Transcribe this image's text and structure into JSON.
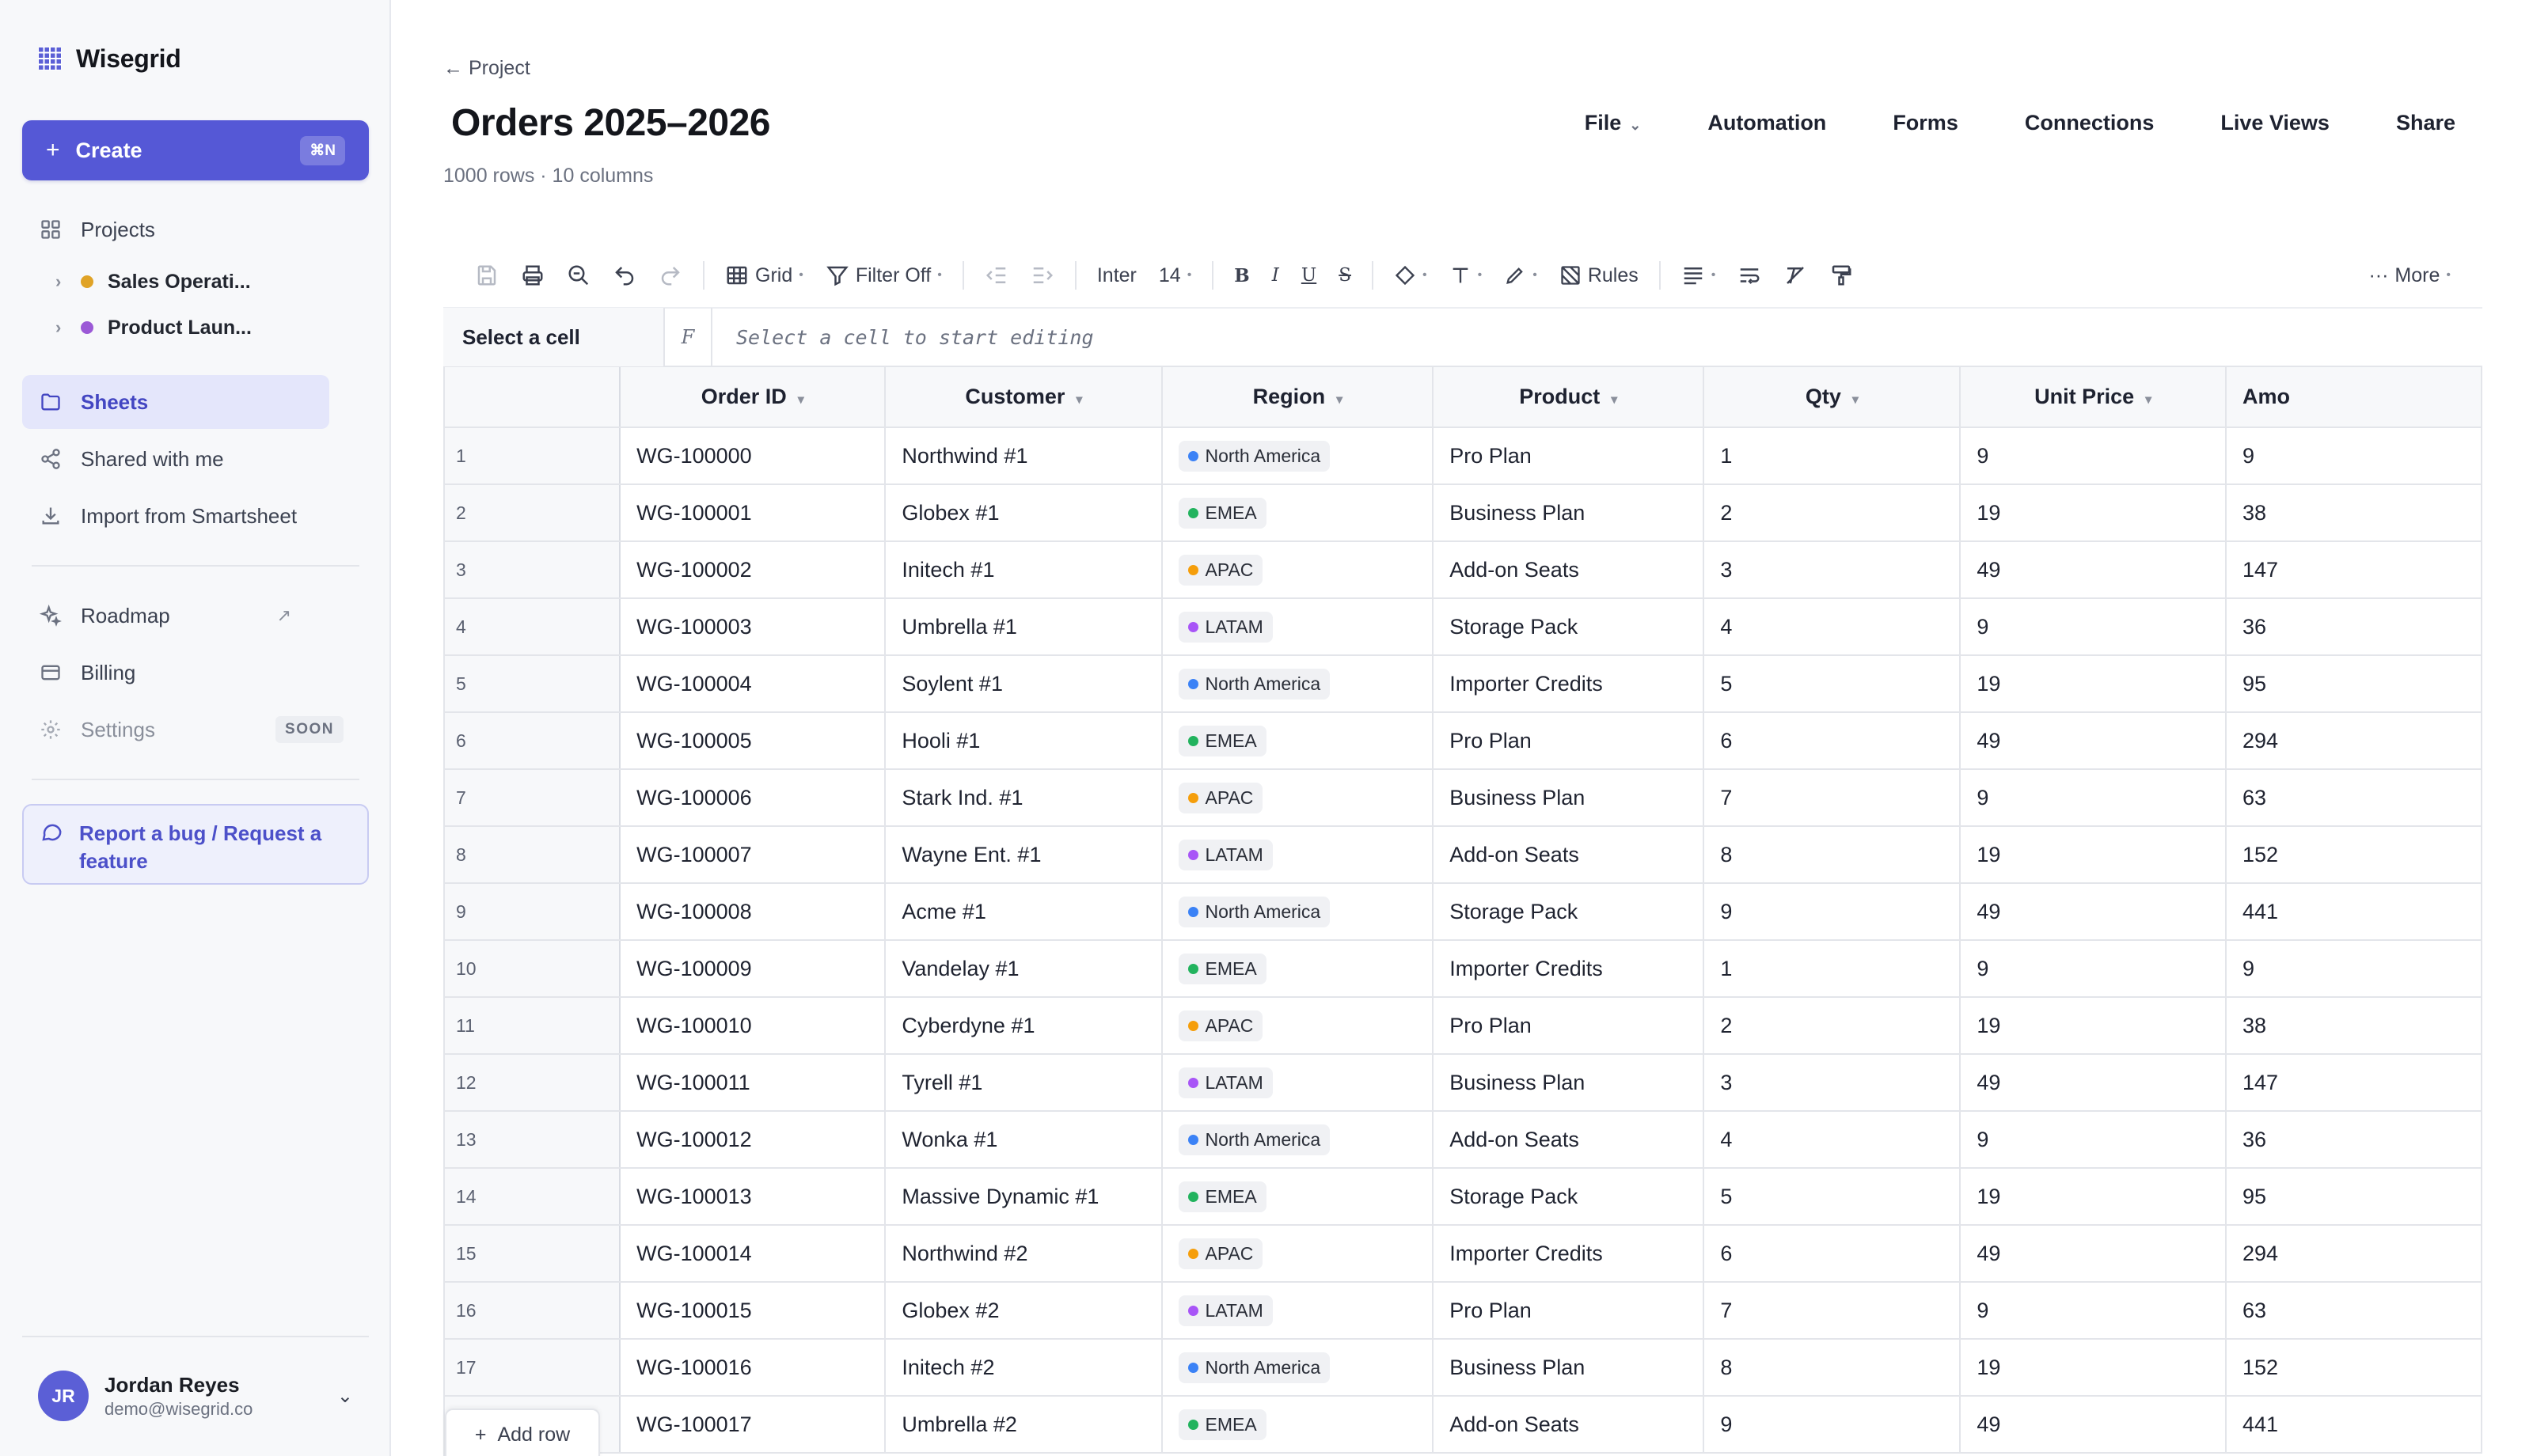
{
  "brand": {
    "name": "Wisegrid"
  },
  "sidebar": {
    "create": {
      "label": "Create",
      "shortcut": "⌘N"
    },
    "projects_label": "Projects",
    "projects": [
      {
        "label": "Sales Operati...",
        "color": "#e0a326"
      },
      {
        "label": "Product Laun...",
        "color": "#9b59d6"
      }
    ],
    "nav": [
      {
        "label": "Sheets"
      },
      {
        "label": "Shared with me"
      },
      {
        "label": "Import from Smartsheet"
      }
    ],
    "nav2": [
      {
        "label": "Roadmap"
      },
      {
        "label": "Billing"
      },
      {
        "label": "Settings",
        "badge": "SOON"
      }
    ],
    "bug_report": "Report a bug / Request a feature",
    "user": {
      "initials": "JR",
      "name": "Jordan Reyes",
      "email": "demo@wisegrid.co"
    }
  },
  "header": {
    "back": "Project",
    "title": "Orders 2025–2026",
    "subtitle": "1000 rows · 10 columns",
    "nav": [
      "File",
      "Automation",
      "Forms",
      "Connections",
      "Live Views",
      "Share"
    ]
  },
  "toolbar": {
    "view": "Grid",
    "filter": "Filter Off",
    "font": "Inter",
    "font_size": "14",
    "bold": "B",
    "italic": "I",
    "underline": "U",
    "strike": "S",
    "rules": "Rules",
    "more": "More"
  },
  "formula_bar": {
    "cell_ref": "Select a cell",
    "fx": "F",
    "placeholder": "Select a cell to start editing"
  },
  "grid": {
    "columns": [
      "Order ID",
      "Customer",
      "Region",
      "Product",
      "Qty",
      "Unit Price",
      "Amo"
    ],
    "region_colors": {
      "North America": "#3b82f6",
      "EMEA": "#22b35e",
      "APAC": "#f59e0b",
      "LATAM": "#a855f7"
    },
    "rows": [
      [
        "1",
        "WG-100000",
        "Northwind #1",
        "North America",
        "Pro Plan",
        "1",
        "9",
        "9"
      ],
      [
        "2",
        "WG-100001",
        "Globex #1",
        "EMEA",
        "Business Plan",
        "2",
        "19",
        "38"
      ],
      [
        "3",
        "WG-100002",
        "Initech #1",
        "APAC",
        "Add-on Seats",
        "3",
        "49",
        "147"
      ],
      [
        "4",
        "WG-100003",
        "Umbrella #1",
        "LATAM",
        "Storage Pack",
        "4",
        "9",
        "36"
      ],
      [
        "5",
        "WG-100004",
        "Soylent #1",
        "North America",
        "Importer Credits",
        "5",
        "19",
        "95"
      ],
      [
        "6",
        "WG-100005",
        "Hooli #1",
        "EMEA",
        "Pro Plan",
        "6",
        "49",
        "294"
      ],
      [
        "7",
        "WG-100006",
        "Stark Ind. #1",
        "APAC",
        "Business Plan",
        "7",
        "9",
        "63"
      ],
      [
        "8",
        "WG-100007",
        "Wayne Ent. #1",
        "LATAM",
        "Add-on Seats",
        "8",
        "19",
        "152"
      ],
      [
        "9",
        "WG-100008",
        "Acme #1",
        "North America",
        "Storage Pack",
        "9",
        "49",
        "441"
      ],
      [
        "10",
        "WG-100009",
        "Vandelay #1",
        "EMEA",
        "Importer Credits",
        "1",
        "9",
        "9"
      ],
      [
        "11",
        "WG-100010",
        "Cyberdyne #1",
        "APAC",
        "Pro Plan",
        "2",
        "19",
        "38"
      ],
      [
        "12",
        "WG-100011",
        "Tyrell #1",
        "LATAM",
        "Business Plan",
        "3",
        "49",
        "147"
      ],
      [
        "13",
        "WG-100012",
        "Wonka #1",
        "North America",
        "Add-on Seats",
        "4",
        "9",
        "36"
      ],
      [
        "14",
        "WG-100013",
        "Massive Dynamic #1",
        "EMEA",
        "Storage Pack",
        "5",
        "19",
        "95"
      ],
      [
        "15",
        "WG-100014",
        "Northwind #2",
        "APAC",
        "Importer Credits",
        "6",
        "49",
        "294"
      ],
      [
        "16",
        "WG-100015",
        "Globex #2",
        "LATAM",
        "Pro Plan",
        "7",
        "9",
        "63"
      ],
      [
        "17",
        "WG-100016",
        "Initech #2",
        "North America",
        "Business Plan",
        "8",
        "19",
        "152"
      ],
      [
        "",
        "WG-100017",
        "Umbrella #2",
        "EMEA",
        "Add-on Seats",
        "9",
        "49",
        "441"
      ]
    ],
    "add_row": "Add row"
  }
}
